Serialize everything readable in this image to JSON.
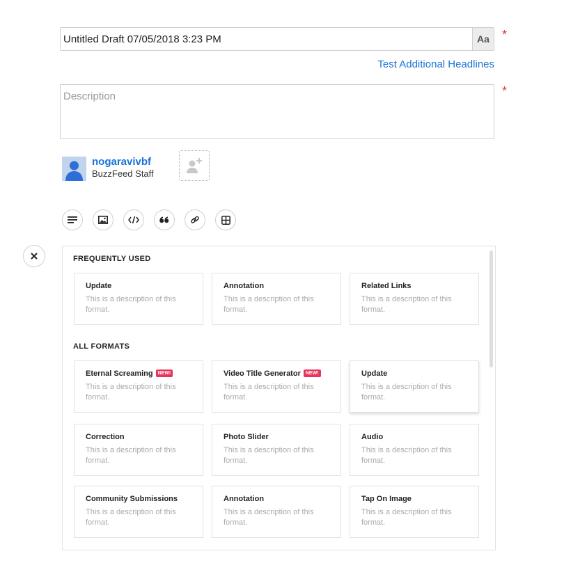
{
  "title_field": {
    "value": "Untitled Draft 07/05/2018 3:23 PM",
    "font_button": "Aa",
    "required_mark": "*"
  },
  "headline_link": "Test Additional Headlines",
  "description_field": {
    "placeholder": "Description",
    "value": "",
    "required_mark": "*"
  },
  "author": {
    "name": "nogaravivbf",
    "role": "BuzzFeed Staff"
  },
  "toolbar": [
    "text-icon",
    "image-icon",
    "code-icon",
    "quote-icon",
    "link-icon",
    "table-icon"
  ],
  "formats_panel": {
    "frequently_used_heading": "FREQUENTLY USED",
    "all_formats_heading": "ALL FORMATS",
    "badge_label": "NEW!",
    "frequently_used": [
      {
        "title": "Update",
        "desc": "This is a description of this format."
      },
      {
        "title": "Annotation",
        "desc": "This is a description of this format."
      },
      {
        "title": "Related Links",
        "desc": "This is a description of this format."
      }
    ],
    "all_formats": [
      {
        "title": "Eternal Screaming",
        "desc": "This is a description of this format.",
        "new": true
      },
      {
        "title": "Video Title Generator",
        "desc": "This is a description of this format.",
        "new": true
      },
      {
        "title": "Update",
        "desc": "This is a description of this format.",
        "new": false
      },
      {
        "title": "Correction",
        "desc": "This is a description of this format.",
        "new": false
      },
      {
        "title": "Photo Slider",
        "desc": "This is a description of this format.",
        "new": false
      },
      {
        "title": "Audio",
        "desc": "This is a description of this format.",
        "new": false
      },
      {
        "title": "Community Submissions",
        "desc": "This is a description of this format.",
        "new": false
      },
      {
        "title": "Annotation",
        "desc": "This is a description of this format.",
        "new": false
      },
      {
        "title": "Tap On Image",
        "desc": "This is a description of this format.",
        "new": false
      }
    ]
  },
  "colors": {
    "link": "#1a73d9",
    "required": "#e23a3a",
    "new_badge": "#e8335a",
    "avatar_bg": "#c2d3ee"
  }
}
